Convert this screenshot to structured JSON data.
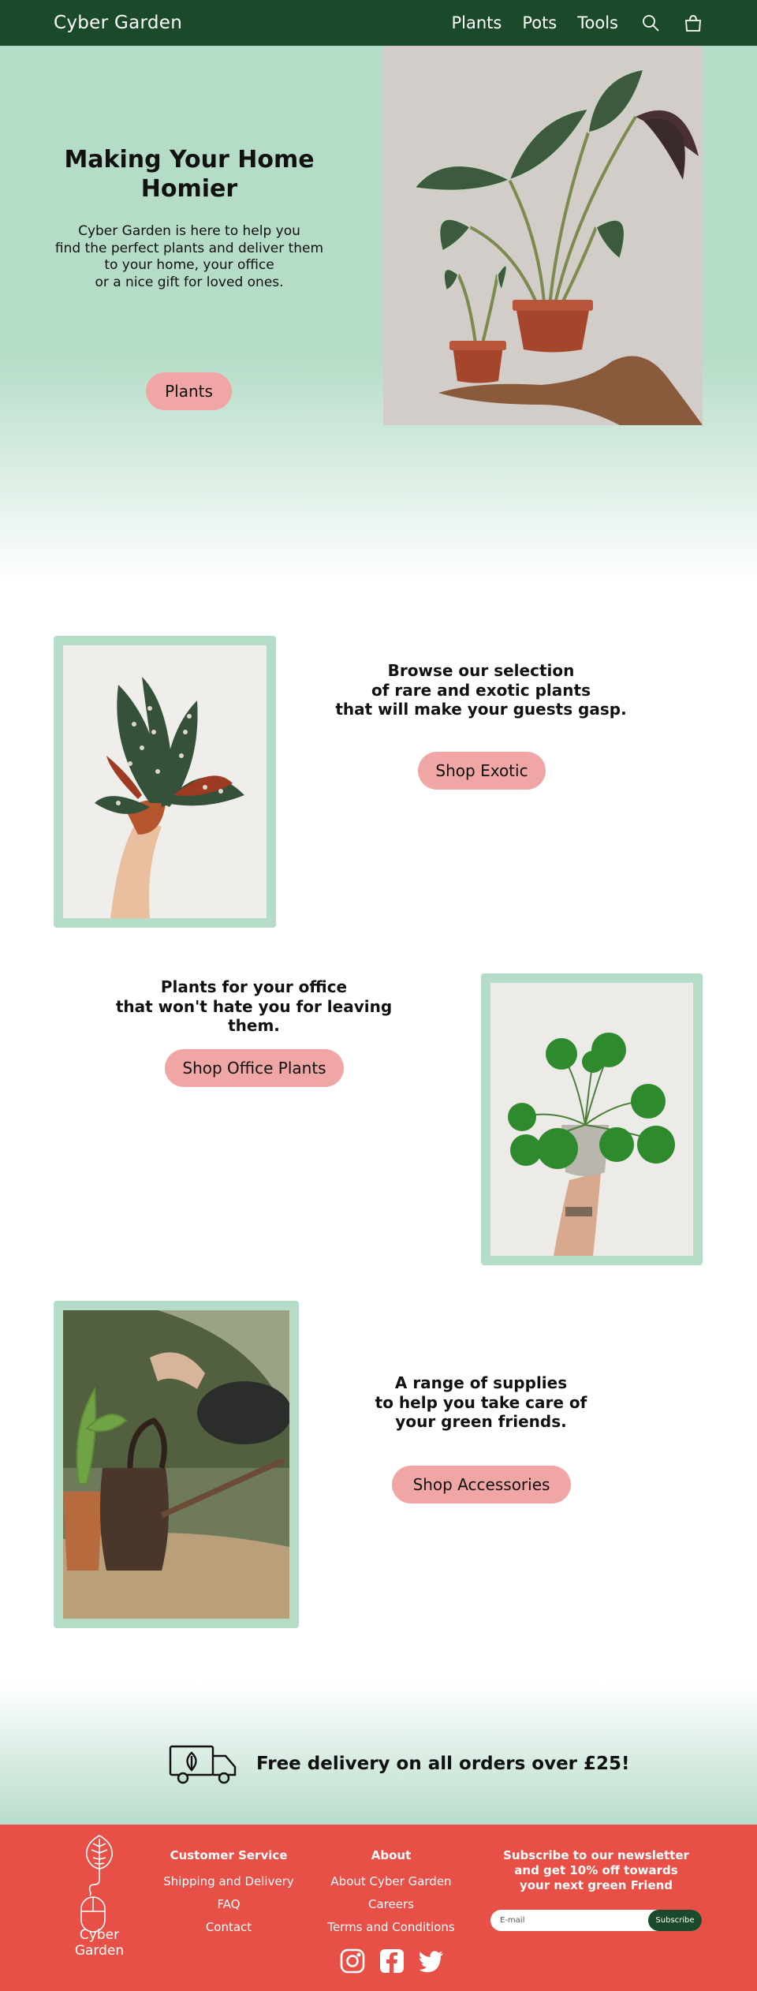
{
  "nav": {
    "brand": "Cyber Garden",
    "links": [
      "Plants",
      "Pots",
      "Tools"
    ],
    "icons": [
      "search-icon",
      "shopping-bag-icon"
    ]
  },
  "hero": {
    "title": "Making Your Home\nHomier",
    "title_line1": "Making Your Home",
    "title_line2": "Homier",
    "description": "Cyber Garden is here to help you\nfind the perfect plants and deliver them\nto your home, your office\nor a nice gift for loved ones.",
    "button": "Plants"
  },
  "features": [
    {
      "text": "Browse our selection\nof rare and exotic plants\nthat will make your guests gasp.",
      "button": "Shop Exotic"
    },
    {
      "text": "Plants for your office\nthat won't hate you for leaving them.",
      "button": "Shop Office Plants"
    },
    {
      "text": "A range of supplies\nto help you take care of\nyour green friends.",
      "button": "Shop Accessories"
    }
  ],
  "delivery": {
    "text": "Free delivery on all orders over £25!"
  },
  "footer": {
    "brand": "Cyber Garden",
    "customer_service": {
      "heading": "Customer Service",
      "items": [
        "Shipping and Delivery",
        "FAQ",
        "Contact"
      ]
    },
    "about": {
      "heading": "About",
      "items": [
        "About Cyber Garden",
        "Careers",
        "Terms and Conditions"
      ]
    },
    "newsletter": {
      "title": "Subscribe to our newsletter\nand get 10% off towards\nyour next green Friend",
      "placeholder": "E-mail",
      "button": "Subscribe"
    },
    "socials": [
      "instagram-icon",
      "facebook-icon",
      "twitter-icon"
    ]
  },
  "colors": {
    "nav_bg": "#1a4a2a",
    "mint": "#b5dcc7",
    "pill": "#efa6a5",
    "footer_bg": "#e84f46"
  }
}
